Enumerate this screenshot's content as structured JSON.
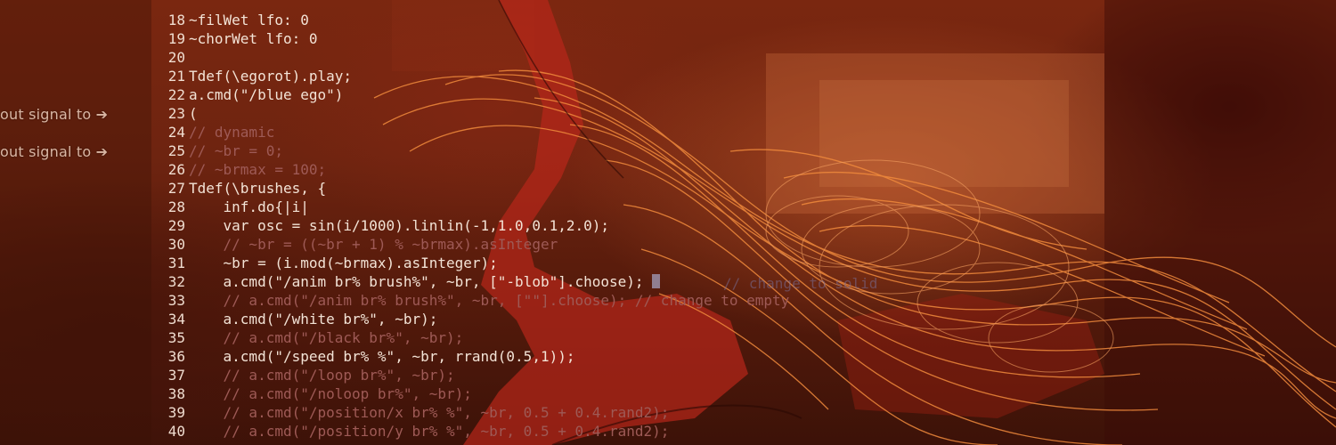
{
  "side_panel": {
    "labels": [
      "out signal to ➔",
      "out signal to ➔"
    ]
  },
  "editor": {
    "lines": [
      {
        "n": "18",
        "text": "~filWet lfo: 0",
        "comment": false
      },
      {
        "n": "19",
        "text": "~chorWet lfo: 0",
        "comment": false
      },
      {
        "n": "20",
        "text": "",
        "comment": false
      },
      {
        "n": "21",
        "text": "Tdef(\\egorot).play;",
        "comment": false
      },
      {
        "n": "22",
        "text": "a.cmd(\"/blue ego\")",
        "comment": false
      },
      {
        "n": "23",
        "text": "(",
        "comment": false
      },
      {
        "n": "24",
        "text": "// dynamic",
        "comment": true
      },
      {
        "n": "25",
        "text": "// ~br = 0;",
        "comment": true
      },
      {
        "n": "26",
        "text": "// ~brmax = 100;",
        "comment": true
      },
      {
        "n": "27",
        "text": "Tdef(\\brushes, {",
        "comment": false
      },
      {
        "n": "28",
        "text": "    inf.do{|i|",
        "comment": false
      },
      {
        "n": "29",
        "text": "    var osc = sin(i/1000).linlin(-1,1.0,0.1,2.0);",
        "comment": false
      },
      {
        "n": "30",
        "text": "    // ~br = ((~br + 1) % ~brmax).asInteger",
        "comment": true
      },
      {
        "n": "31",
        "text": "    ~br = (i.mod(~brmax).asInteger);",
        "comment": false
      },
      {
        "n": "32",
        "text": "    a.cmd(\"/anim br% brush%\", ~br, [\"-blob\"].choose); ",
        "comment": false,
        "cursor": true
      },
      {
        "n": "33",
        "text": "    // a.cmd(\"/anim br% brush%\", ~br, [\"\"].choose); // change to empty",
        "comment": true
      },
      {
        "n": "34",
        "text": "    a.cmd(\"/white br%\", ~br);",
        "comment": false
      },
      {
        "n": "35",
        "text": "    // a.cmd(\"/black br%\", ~br);",
        "comment": true
      },
      {
        "n": "36",
        "text": "    a.cmd(\"/speed br% %\", ~br, rrand(0.5,1));",
        "comment": false
      },
      {
        "n": "37",
        "text": "    // a.cmd(\"/loop br%\", ~br);",
        "comment": true
      },
      {
        "n": "38",
        "text": "    // a.cmd(\"/noloop br%\", ~br);",
        "comment": true
      },
      {
        "n": "39",
        "text": "    // a.cmd(\"/position/x br% %\", ~br, 0.5 + 0.4.rand2);",
        "comment": true
      },
      {
        "n": "40",
        "text": "    // a.cmd(\"/position/y br% %\", ~br, 0.5 + 0.4.rand2);",
        "comment": true
      }
    ]
  },
  "ghost": {
    "after_cursor": "// change to solid"
  },
  "colors": {
    "background": "#6e2410",
    "code_text": "#f3e3d6",
    "comment_text": "#9e5a56",
    "stroke_orange": "#f08a3c",
    "figure_red": "#b8261a"
  }
}
